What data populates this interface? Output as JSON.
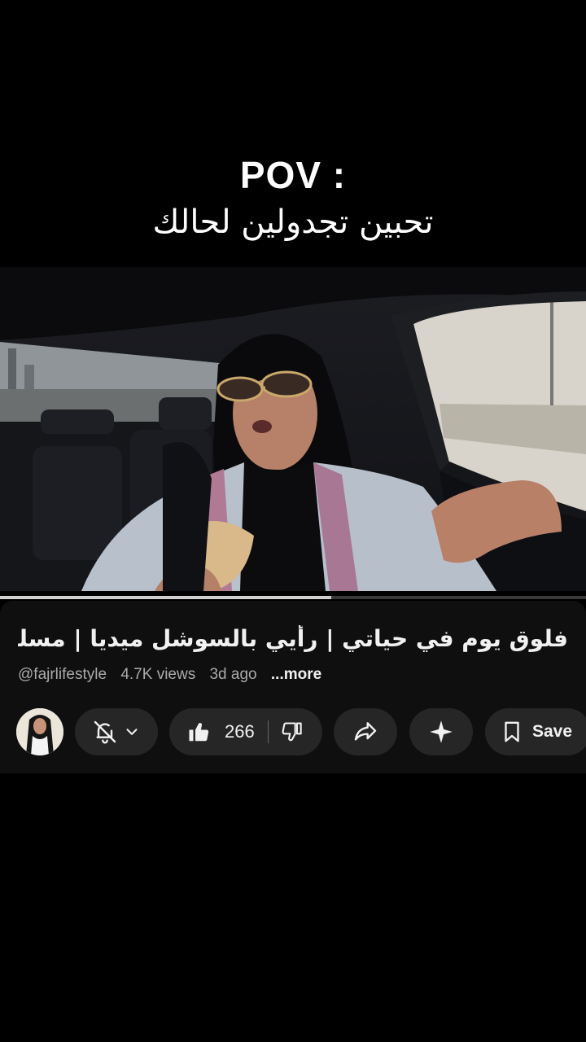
{
  "overlay_caption": {
    "line1": "POV :",
    "line2": "تحبين تجدولين لحالك"
  },
  "video": {
    "progress_fraction": 0.565
  },
  "details": {
    "title": "فلوق يوم في حياتي | رأيي بالسوشل ميديا | مسلس..",
    "channel_handle": "@fajrlifestyle",
    "views": "4.7K views",
    "age": "3d ago",
    "more_label": "...more"
  },
  "actions": {
    "like_count": "266",
    "save_label": "Save"
  },
  "icons": {
    "bell": "bell-off-icon",
    "chevron": "chevron-down-icon",
    "like": "thumbs-up-icon",
    "dislike": "thumbs-down-icon",
    "share": "share-icon",
    "remix": "sparkle-icon",
    "save": "bookmark-icon"
  },
  "colors": {
    "background": "#000000",
    "panel": "#0f0f0f",
    "pill": "#262626",
    "text_primary": "#f1f1f1",
    "text_secondary": "#aaaaaa"
  }
}
